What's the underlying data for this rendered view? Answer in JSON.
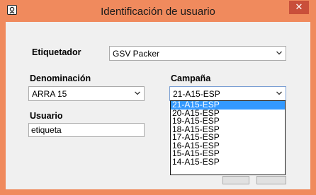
{
  "window": {
    "title": "Identificación de usuario",
    "close_glyph": "✕"
  },
  "form": {
    "etiquetador": {
      "label": "Etiquetador",
      "value": "GSV Packer"
    },
    "denominacion": {
      "label": "Denominación",
      "value": "ARRA 15"
    },
    "campana": {
      "label": "Campaña",
      "value": "21-A15-ESP",
      "options": [
        "21-A15-ESP",
        "20-A15-ESP",
        "19-A15-ESP",
        "18-A15-ESP",
        "17-A15-ESP",
        "16-A15-ESP",
        "15-A15-ESP",
        "14-A15-ESP"
      ],
      "highlighted": "21-A15-ESP"
    },
    "usuario": {
      "label": "Usuario",
      "value": "etiqueta"
    }
  },
  "icons": {
    "app": "user-id-icon",
    "chevron": "chevron-down-icon",
    "close": "close-icon"
  }
}
